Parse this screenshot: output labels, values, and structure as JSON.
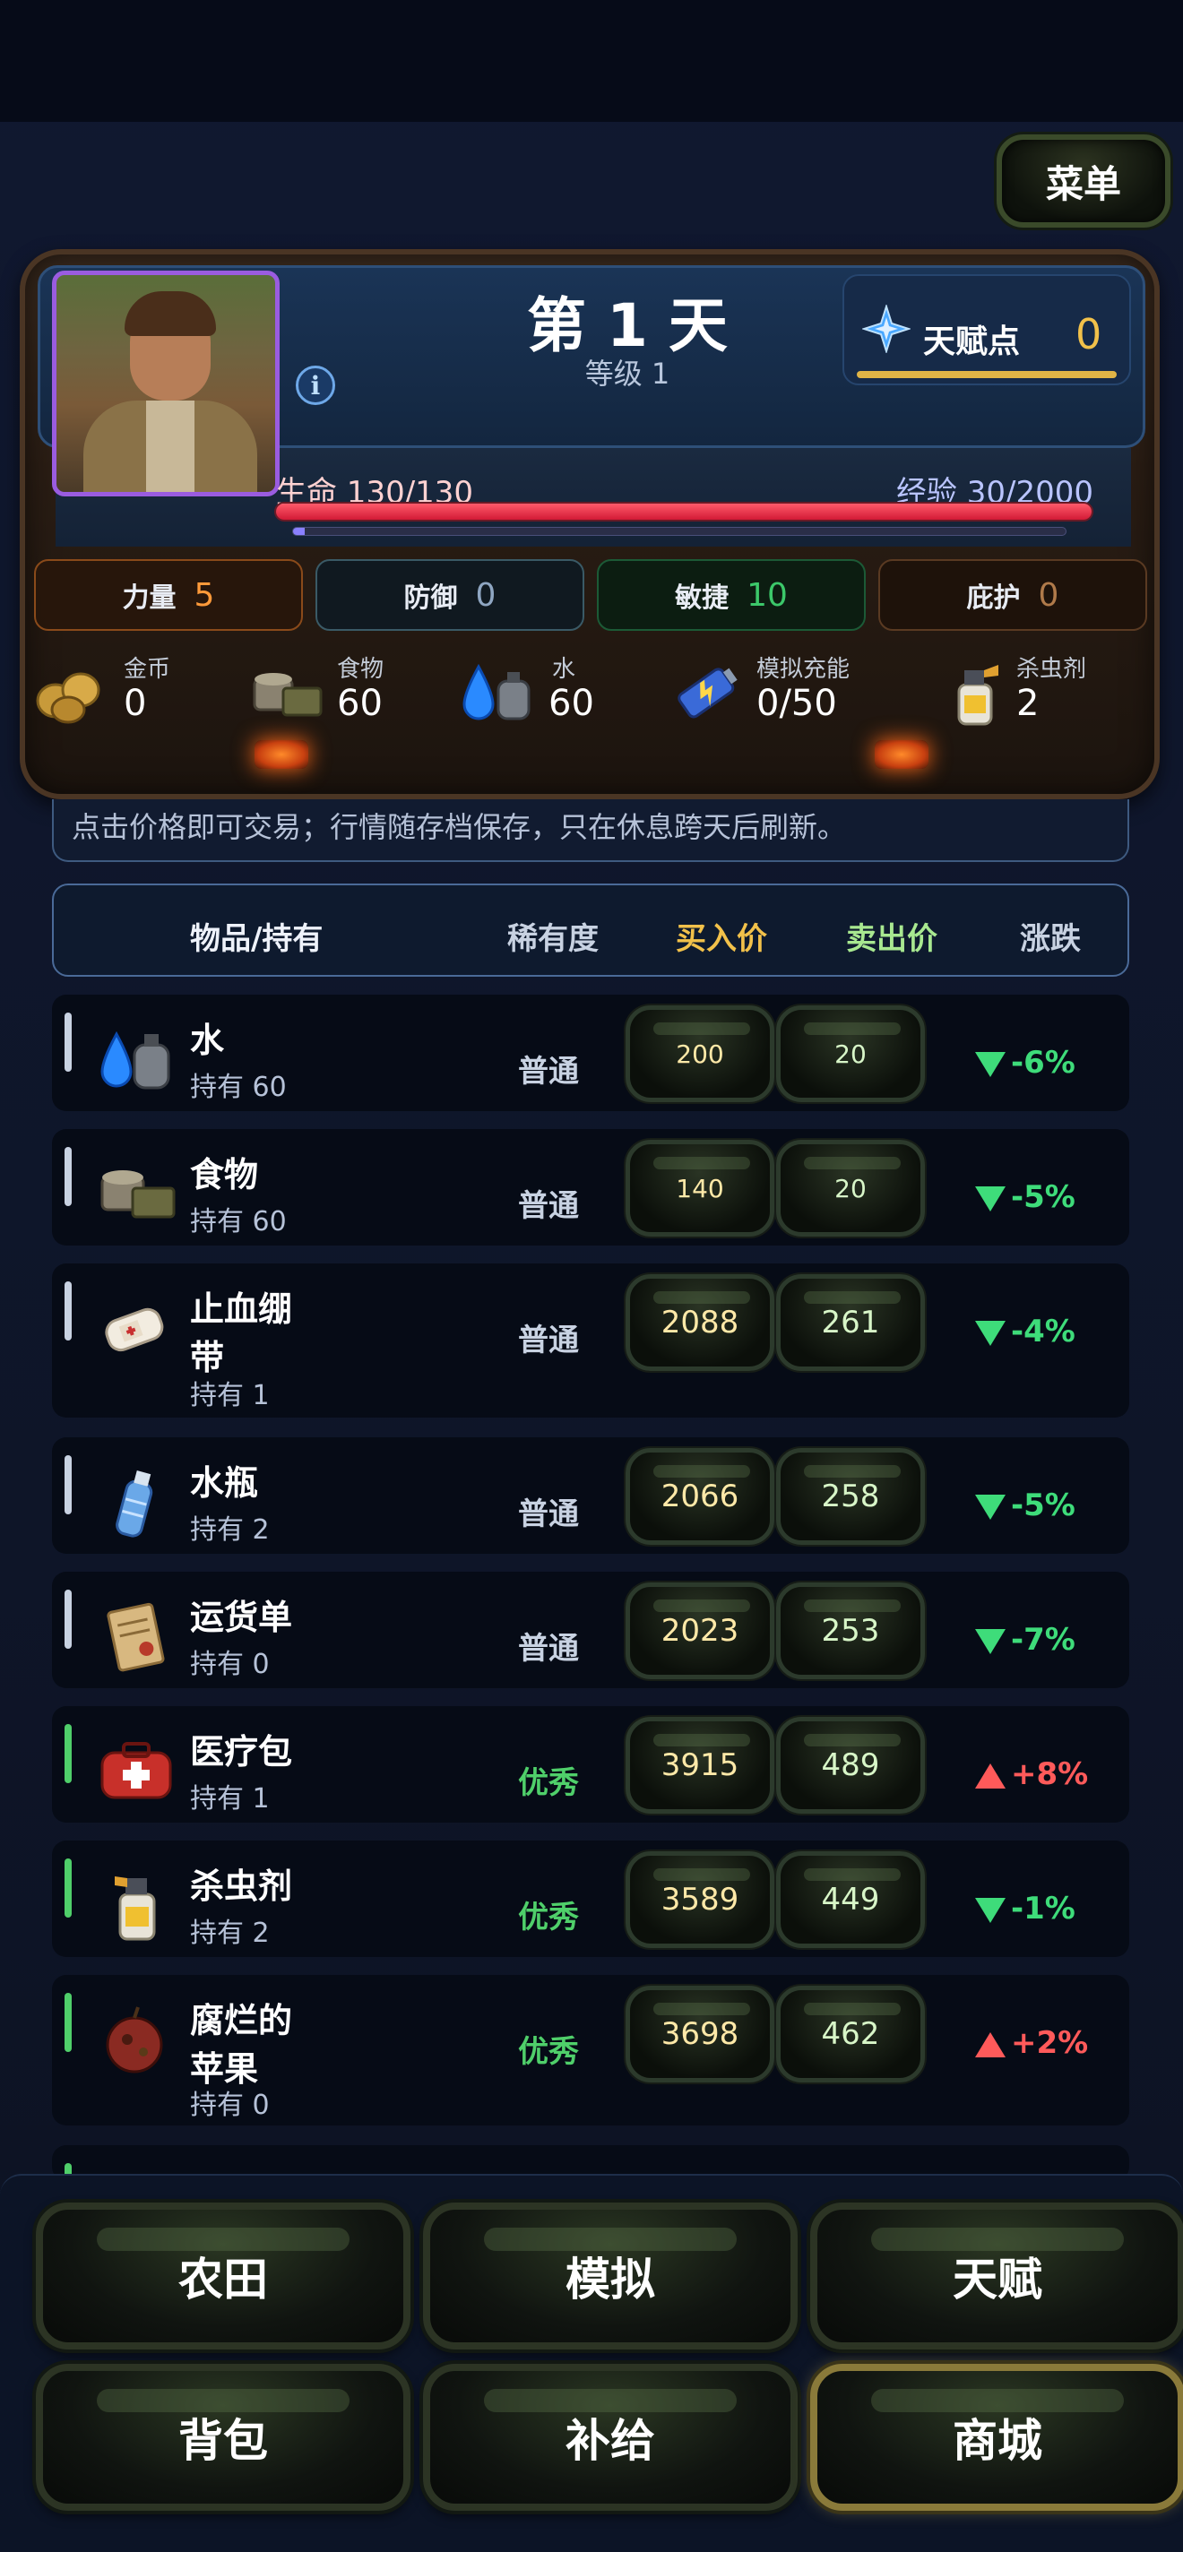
{
  "menu_label": "菜单",
  "header": {
    "day": "第 1 天",
    "level": "等级 1",
    "info_glyph": "i",
    "talent_label": "天赋点",
    "talent_value": "0",
    "hp_label": "生命 130/130",
    "hp_fraction": 1.0,
    "exp_label": "经验 30/2000",
    "exp_fraction": 0.015
  },
  "stats": [
    {
      "label": "力量",
      "value": "5"
    },
    {
      "label": "防御",
      "value": "0"
    },
    {
      "label": "敏捷",
      "value": "10"
    },
    {
      "label": "庇护",
      "value": "0"
    }
  ],
  "resources": [
    {
      "label": "金币",
      "value": "0",
      "icon": "coins-icon"
    },
    {
      "label": "食物",
      "value": "60",
      "icon": "food-can-icon"
    },
    {
      "label": "水",
      "value": "60",
      "icon": "water-icon"
    },
    {
      "label": "模拟充能",
      "value": "0/50",
      "icon": "battery-icon"
    },
    {
      "label": "杀虫剂",
      "value": "2",
      "icon": "spray-bottle-icon"
    }
  ],
  "notice": "点击价格即可交易；行情随存档保存，只在休息跨天后刷新。",
  "table_header": {
    "item": "物品/持有",
    "rarity": "稀有度",
    "buy": "买入价",
    "sell": "卖出价",
    "change": "涨跌"
  },
  "rows": [
    {
      "name": "水",
      "owned": "持有 60",
      "rarity": "普通",
      "buy": "200",
      "sell": "20",
      "change": "-6%",
      "dir": "down",
      "icon": "water-icon"
    },
    {
      "name": "食物",
      "owned": "持有 60",
      "rarity": "普通",
      "buy": "140",
      "sell": "20",
      "change": "-5%",
      "dir": "down",
      "icon": "food-can-icon"
    },
    {
      "name": "止血绷带",
      "owned": "持有 1",
      "rarity": "普通",
      "buy": "2088",
      "sell": "261",
      "change": "-4%",
      "dir": "down",
      "icon": "bandage-icon"
    },
    {
      "name": "水瓶",
      "owned": "持有 2",
      "rarity": "普通",
      "buy": "2066",
      "sell": "258",
      "change": "-5%",
      "dir": "down",
      "icon": "water-bottle-icon"
    },
    {
      "name": "运货单",
      "owned": "持有 0",
      "rarity": "普通",
      "buy": "2023",
      "sell": "253",
      "change": "-7%",
      "dir": "down",
      "icon": "scroll-icon"
    },
    {
      "name": "医疗包",
      "owned": "持有 1",
      "rarity": "优秀",
      "buy": "3915",
      "sell": "489",
      "change": "+8%",
      "dir": "up",
      "icon": "medkit-icon"
    },
    {
      "name": "杀虫剂",
      "owned": "持有 2",
      "rarity": "优秀",
      "buy": "3589",
      "sell": "449",
      "change": "-1%",
      "dir": "down",
      "icon": "spray-bottle-icon"
    },
    {
      "name": "腐烂的苹果",
      "owned": "持有 0",
      "rarity": "优秀",
      "buy": "3698",
      "sell": "462",
      "change": "+2%",
      "dir": "up",
      "icon": "rotten-apple-icon"
    }
  ],
  "nav": [
    "农田",
    "模拟",
    "天赋",
    "背包",
    "补给",
    "商城"
  ],
  "colors": {
    "common": "#c8d2e2",
    "excellent": "#4fcf6a",
    "price_buy": "#ffe9a8",
    "price_sell": "#d8f6c8",
    "down": "#3edc7a",
    "up": "#ff5a5a",
    "talent": "#f2c14a"
  }
}
